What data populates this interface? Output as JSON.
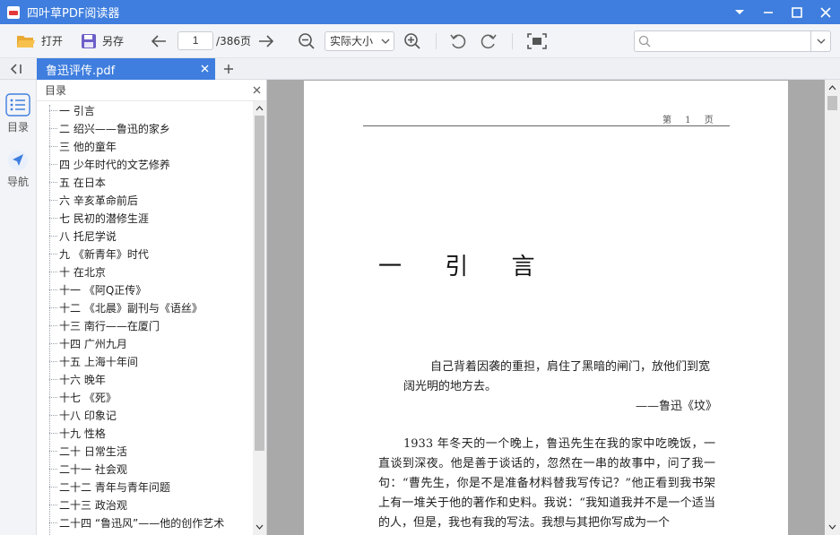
{
  "titlebar": {
    "title": "四叶草PDF阅读器"
  },
  "toolbar": {
    "open_label": "打开",
    "save_as_label": "另存",
    "current_page": "1",
    "total_pages": "/386页",
    "zoom_mode": "实际大小",
    "search_placeholder": ""
  },
  "tabs": [
    {
      "label": "鲁迅评传.pdf",
      "active": true
    }
  ],
  "rail": {
    "toc_label": "目录",
    "nav_label": "导航"
  },
  "toc": {
    "title": "目录",
    "items": [
      "一  引言",
      "二  绍兴——鲁迅的家乡",
      "三  他的童年",
      "四  少年时代的文艺修养",
      "五  在日本",
      "六  辛亥革命前后",
      "七  民初的潜修生涯",
      "八  托尼学说",
      "九  《新青年》时代",
      "十  在北京",
      "十一  《阿Q正传》",
      "十二  《北晨》副刊与《语丝》",
      "十三  南行——在厦门",
      "十四  广州九月",
      "十五  上海十年间",
      "十六  晚年",
      "十七  《死》",
      "十八  印象记",
      "十九  性格",
      "二十  日常生活",
      "二十一  社会观",
      "二十二  青年与青年问题",
      "二十三  政治观",
      "二十四 “鲁迅风”——他的创作艺术"
    ]
  },
  "document": {
    "running_head": "第 1 页",
    "chapter_title": "一  引  言",
    "epigraph": "自己背着因袭的重担，肩住了黑暗的闸门，放他们到宽阔光明的地方去。",
    "epigraph_source": "——鲁迅《坟》",
    "body": "1933 年冬天的一个晚上，鲁迅先生在我的家中吃晚饭，一直谈到深夜。他是善于谈话的，忽然在一串的故事中，问了我一句：“曹先生，你是不是准备材料替我写传记？”他正看到我书架上有一堆关于他的著作和史料。我说：“我知道我并不是一个适当的人，但是，我也有我的写法。我想与其把你写成为一个"
  },
  "colors": {
    "accent": "#3f7ede",
    "toolbar_bg": "#f3f4f7",
    "doc_bg": "#a9a9a9"
  }
}
